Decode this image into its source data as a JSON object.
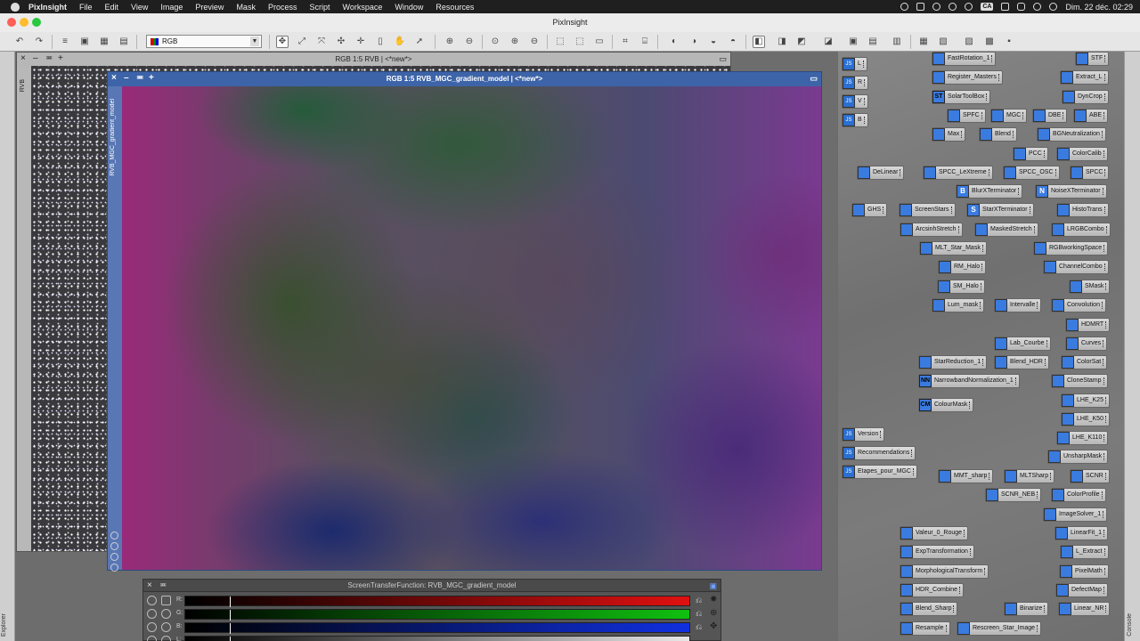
{
  "menubar": {
    "app": "PixInsight",
    "items": [
      "File",
      "Edit",
      "View",
      "Image",
      "Preview",
      "Mask",
      "Process",
      "Script",
      "Workspace",
      "Window",
      "Resources"
    ],
    "status_badge": "CA",
    "clock": "Dim. 22 déc. 02:29"
  },
  "window_title": "PixInsight",
  "toolbar": {
    "view_selector": "RGB"
  },
  "explorer_label": "Explorer",
  "console_label": "Console",
  "back_window": {
    "title": "RGB 1:5 RVB | <*new*>",
    "side_label": "RVB"
  },
  "front_window": {
    "title": "RGB 1:5 RVB_MGC_gradient_model | <*new*>",
    "side_label": "RVB_MGC_gradient_model"
  },
  "stf": {
    "title": "ScreenTransferFunction: RVB_MGC_gradient_model",
    "channels": [
      {
        "label": "R:",
        "color": "#e01010"
      },
      {
        "label": "G:",
        "color": "#10c010"
      },
      {
        "label": "B:",
        "color": "#1030e0"
      },
      {
        "label": "L:",
        "color": "#e8e8e8"
      }
    ]
  },
  "shelf_icons": [
    {
      "id": "fastrotation",
      "label": "FastRotation_1",
      "kind": "proc"
    },
    {
      "id": "stf",
      "label": "STF",
      "kind": "proc"
    },
    {
      "id": "l",
      "label": "L",
      "kind": "script"
    },
    {
      "id": "register",
      "label": "Register_Masters",
      "kind": "proc"
    },
    {
      "id": "extractl",
      "label": "Extract_L",
      "kind": "proc"
    },
    {
      "id": "r",
      "label": "R",
      "kind": "script"
    },
    {
      "id": "solartoolbox",
      "label": "SolarToolBox",
      "glyph": "ST"
    },
    {
      "id": "dyncrop",
      "label": "DynCrop",
      "kind": "proc"
    },
    {
      "id": "v",
      "label": "V",
      "kind": "script"
    },
    {
      "id": "spfc",
      "label": "SPFC",
      "kind": "proc"
    },
    {
      "id": "mgc",
      "label": "MGC",
      "kind": "proc"
    },
    {
      "id": "dbe",
      "label": "DBE",
      "kind": "proc"
    },
    {
      "id": "abe",
      "label": "ABE",
      "kind": "proc"
    },
    {
      "id": "b",
      "label": "B",
      "kind": "script"
    },
    {
      "id": "max",
      "label": "Max",
      "kind": "proc"
    },
    {
      "id": "blend",
      "label": "Blend",
      "kind": "proc"
    },
    {
      "id": "bgneutral",
      "label": "BGNeutralization",
      "kind": "proc"
    },
    {
      "id": "pcc",
      "label": "PCC",
      "kind": "proc"
    },
    {
      "id": "colorcalib",
      "label": "ColorCalib",
      "kind": "proc"
    },
    {
      "id": "delinear",
      "label": "DeLinear",
      "kind": "proc"
    },
    {
      "id": "spcclextreme",
      "label": "SPCC_LeXtreme",
      "kind": "proc"
    },
    {
      "id": "spccosc",
      "label": "SPCC_OSC",
      "kind": "proc"
    },
    {
      "id": "spcc",
      "label": "SPCC",
      "kind": "proc"
    },
    {
      "id": "blurx",
      "label": "BlurXTerminator",
      "glyph": "B"
    },
    {
      "id": "noisex",
      "label": "NoiseXTerminator",
      "glyph": "N"
    },
    {
      "id": "ghs",
      "label": "GHS",
      "kind": "proc"
    },
    {
      "id": "screenstars",
      "label": "ScreenStars",
      "kind": "proc"
    },
    {
      "id": "starx",
      "label": "StarXTerminator",
      "glyph": "S"
    },
    {
      "id": "histotrans",
      "label": "HistoTrans",
      "kind": "proc"
    },
    {
      "id": "arcsinh",
      "label": "ArcsinhStretch",
      "kind": "proc"
    },
    {
      "id": "maskedstretch",
      "label": "MaskedStretch",
      "kind": "proc"
    },
    {
      "id": "lrgbcombo",
      "label": "LRGBCombo",
      "kind": "proc"
    },
    {
      "id": "mltstarmask",
      "label": "MLT_Star_Mask",
      "kind": "proc"
    },
    {
      "id": "rgbws",
      "label": "RGBworkingSpace",
      "kind": "proc"
    },
    {
      "id": "rmhalo",
      "label": "RM_Halo",
      "kind": "proc"
    },
    {
      "id": "channelcombo",
      "label": "ChannelCombo",
      "kind": "proc"
    },
    {
      "id": "smhalo",
      "label": "SM_Halo",
      "kind": "proc"
    },
    {
      "id": "smask",
      "label": "SMask",
      "kind": "proc"
    },
    {
      "id": "lummask",
      "label": "Lum_mask",
      "kind": "proc"
    },
    {
      "id": "intervalle",
      "label": "Intervalle",
      "kind": "proc"
    },
    {
      "id": "convolution",
      "label": "Convolution",
      "kind": "proc"
    },
    {
      "id": "hdmrt",
      "label": "HDMRT",
      "kind": "proc"
    },
    {
      "id": "labcourbe",
      "label": "Lab_Courbe",
      "kind": "proc"
    },
    {
      "id": "curves",
      "label": "Curves",
      "kind": "proc"
    },
    {
      "id": "starreduction",
      "label": "StarReduction_1",
      "kind": "proc"
    },
    {
      "id": "blendhdr",
      "label": "Blend_HDR",
      "kind": "proc"
    },
    {
      "id": "colorsat",
      "label": "ColorSat",
      "kind": "proc"
    },
    {
      "id": "narrowband",
      "label": "NarrowbandNormalization_1",
      "glyph": "NN"
    },
    {
      "id": "clonestamp",
      "label": "CloneStamp",
      "kind": "proc"
    },
    {
      "id": "lhek25",
      "label": "LHE_K25",
      "kind": "proc"
    },
    {
      "id": "colourmask",
      "label": "ColourMask",
      "glyph": "CM"
    },
    {
      "id": "lhek50",
      "label": "LHE_K50",
      "kind": "proc"
    },
    {
      "id": "version",
      "label": "Version",
      "kind": "script"
    },
    {
      "id": "lhek110",
      "label": "LHE_K110",
      "kind": "proc"
    },
    {
      "id": "recommendations",
      "label": "Recommendations",
      "kind": "script"
    },
    {
      "id": "unsharpmask",
      "label": "UnsharpMask",
      "kind": "proc"
    },
    {
      "id": "etapes",
      "label": "Etapes_pour_MGC",
      "kind": "script"
    },
    {
      "id": "mmtsharp",
      "label": "MMT_sharp",
      "kind": "proc"
    },
    {
      "id": "mltsharp",
      "label": "MLTSharp",
      "kind": "proc"
    },
    {
      "id": "scnr",
      "label": "SCNR",
      "kind": "proc"
    },
    {
      "id": "scnrneb",
      "label": "SCNR_NEB",
      "kind": "proc"
    },
    {
      "id": "colorprofile",
      "label": "ColorProfile",
      "kind": "proc"
    },
    {
      "id": "imagesolver",
      "label": "ImageSolver_1",
      "kind": "proc"
    },
    {
      "id": "valeur0",
      "label": "Valeur_0_Rouge",
      "kind": "proc"
    },
    {
      "id": "linearfit",
      "label": "LinearFit_1",
      "kind": "proc"
    },
    {
      "id": "exptrans",
      "label": "ExpTransformation",
      "kind": "proc"
    },
    {
      "id": "lextract",
      "label": "L_Extract",
      "kind": "proc"
    },
    {
      "id": "morpho",
      "label": "MorphologicalTransform",
      "kind": "proc"
    },
    {
      "id": "pixelmath",
      "label": "PixelMath",
      "kind": "proc"
    },
    {
      "id": "hdrcombine",
      "label": "HDR_Combine",
      "kind": "proc"
    },
    {
      "id": "defectmap",
      "label": "DefectMap",
      "kind": "proc"
    },
    {
      "id": "blendsharp",
      "label": "Blend_Sharp",
      "kind": "proc"
    },
    {
      "id": "binarize",
      "label": "Binarize",
      "kind": "proc"
    },
    {
      "id": "linearnr",
      "label": "Linear_NR",
      "kind": "proc"
    },
    {
      "id": "resample",
      "label": "Resample",
      "kind": "proc"
    },
    {
      "id": "rescreen",
      "label": "Rescreen_Star_Image",
      "kind": "proc"
    }
  ]
}
